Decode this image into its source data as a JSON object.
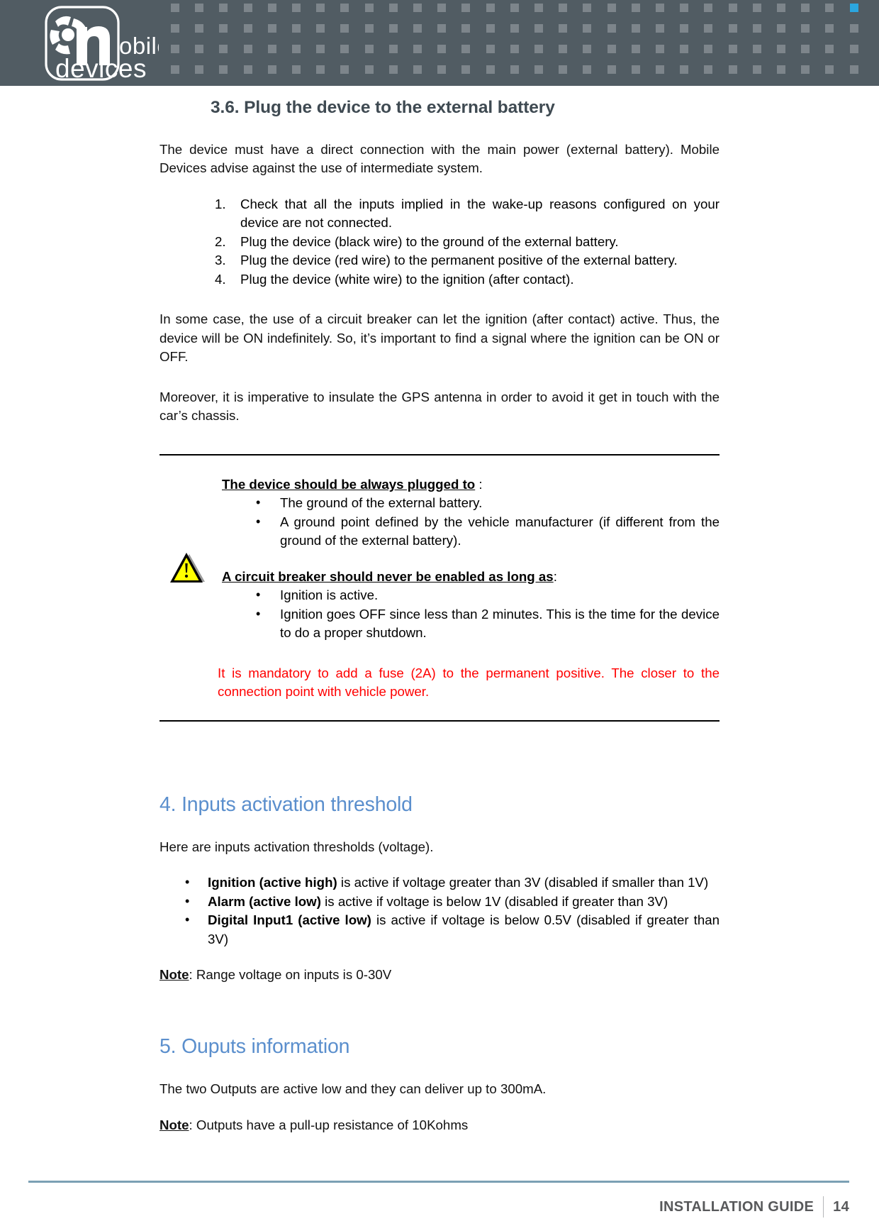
{
  "header": {
    "logo_alt": "mobile devices",
    "logo_word_1": "mobile",
    "logo_word_2": "devices",
    "grid_colors": {
      "default": "#7d858b",
      "accent": "#2ba6df",
      "white": "#f4f7f8"
    }
  },
  "section_36": {
    "heading": "3.6. Plug the device to the external battery",
    "intro": "The device must have a direct connection with the main power (external battery). Mobile Devices advise against the use of intermediate system.",
    "steps": [
      "Check that all the inputs implied in the wake-up reasons configured on your device are not connected.",
      "Plug the device (black wire) to the ground of the external battery.",
      "Plug the device (red wire) to the permanent positive of the external battery.",
      "Plug the device (white wire) to the ignition (after contact)."
    ],
    "para_circuit_breaker": "In some case, the use of a circuit breaker can let the ignition (after contact) active. Thus, the device will be ON indefinitely. So, it’s important to find a signal where the ignition can be ON or OFF.",
    "para_gps": "Moreover, it is imperative to insulate the GPS antenna in order to avoid it get in touch with the car’s chassis."
  },
  "notice": {
    "plugged_lead_bold": "The device should be always plugged to",
    "plugged_lead_tail": " :",
    "plugged_items": [
      "The ground of the external battery.",
      "A ground point defined by the vehicle manufacturer (if different from the ground of the external battery)."
    ],
    "breaker_lead_bold": "A circuit breaker should never be enabled as long as",
    "breaker_lead_tail": ":",
    "breaker_items": [
      "Ignition is active.",
      "Ignition goes OFF since less than 2 minutes. This is the time for the device to do a proper shutdown."
    ],
    "red_warning": "It is mandatory to add a fuse (2A) to the permanent positive. The closer to the connection point with vehicle power.",
    "warning_icon_name": "warning-triangle-icon",
    "warning_icon_colors": {
      "fill": "#ffff00",
      "stroke": "#000000",
      "shadow": "#9a9a9a"
    }
  },
  "section_4": {
    "heading": "4. Inputs activation threshold",
    "intro": "Here are inputs activation thresholds (voltage).",
    "items": [
      {
        "bold": "Ignition (active high)",
        "rest": " is active if voltage greater than 3V (disabled if smaller than 1V)"
      },
      {
        "bold": "Alarm (active low)",
        "rest": " is active if voltage is below 1V (disabled if greater than 3V)"
      },
      {
        "bold": "Digital Input1 (active low)",
        "rest": " is active if voltage is below 0.5V (disabled if greater than 3V)"
      }
    ],
    "note_label": "Note",
    "note_text": ": Range voltage on inputs is 0-30V"
  },
  "section_5": {
    "heading": "5. Ouputs information",
    "para": "The two Outputs are active low and they can deliver up to 300mA.",
    "note_label": "Note",
    "note_text": ": Outputs have a pull-up resistance of 10Kohms"
  },
  "footer": {
    "guide_label": "INSTALLATION GUIDE",
    "page_number": "14",
    "rule_color": "#7ba0b4"
  },
  "theme": {
    "banner_bg": "#515c63",
    "heading_blue": "#5b8fcd",
    "subheading_gray": "#3f4a52",
    "alert_red": "#ff0000"
  }
}
